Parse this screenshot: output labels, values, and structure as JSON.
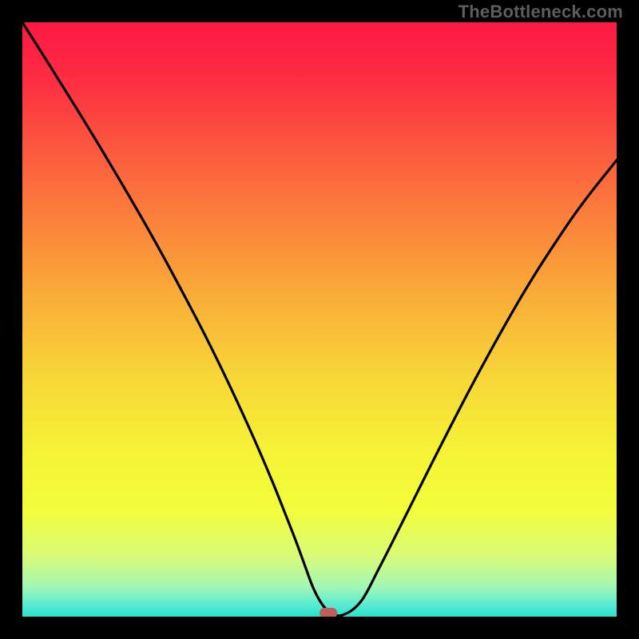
{
  "attribution": "TheBottleneck.com",
  "chart_data": {
    "type": "line",
    "title": "",
    "xlabel": "",
    "ylabel": "",
    "xlim": [
      0,
      100
    ],
    "ylim": [
      0,
      100
    ],
    "grid": false,
    "curve": {
      "name": "bottleneck-curve",
      "x": [
        0,
        3,
        6,
        9,
        12,
        15,
        18,
        21,
        24,
        27,
        30,
        33,
        36,
        39,
        42,
        44,
        46,
        47.5,
        49,
        50.5,
        52,
        54,
        57,
        60,
        63,
        66,
        69,
        72,
        75,
        78,
        81,
        84,
        87,
        90,
        93,
        96,
        100
      ],
      "y": [
        100,
        95.3,
        90.5,
        85.7,
        80.8,
        75.8,
        70.7,
        65.5,
        60.1,
        54.5,
        48.8,
        42.8,
        36.5,
        29.9,
        22.9,
        17.9,
        12.8,
        8.7,
        4.7,
        2.0,
        0.6,
        0.3,
        2.6,
        8.1,
        14.0,
        20.0,
        26.0,
        31.9,
        37.7,
        43.3,
        48.7,
        53.9,
        58.8,
        63.4,
        67.8,
        71.8,
        76.8
      ]
    },
    "marker": {
      "x": 51.5,
      "y": 0.6,
      "color": "#bf5e5a"
    },
    "gradient_stops": [
      {
        "pos": 0.0,
        "color": "#fd1845"
      },
      {
        "pos": 0.1,
        "color": "#fd2e42"
      },
      {
        "pos": 0.22,
        "color": "#fc5b3e"
      },
      {
        "pos": 0.35,
        "color": "#fb873b"
      },
      {
        "pos": 0.48,
        "color": "#f9b338"
      },
      {
        "pos": 0.6,
        "color": "#f7d737"
      },
      {
        "pos": 0.72,
        "color": "#f5f236"
      },
      {
        "pos": 0.82,
        "color": "#f3fd3a"
      },
      {
        "pos": 0.9,
        "color": "#d7fb79"
      },
      {
        "pos": 0.95,
        "color": "#a2f6b5"
      },
      {
        "pos": 0.985,
        "color": "#4de9d6"
      },
      {
        "pos": 1.0,
        "color": "#2ae3c6"
      }
    ]
  }
}
